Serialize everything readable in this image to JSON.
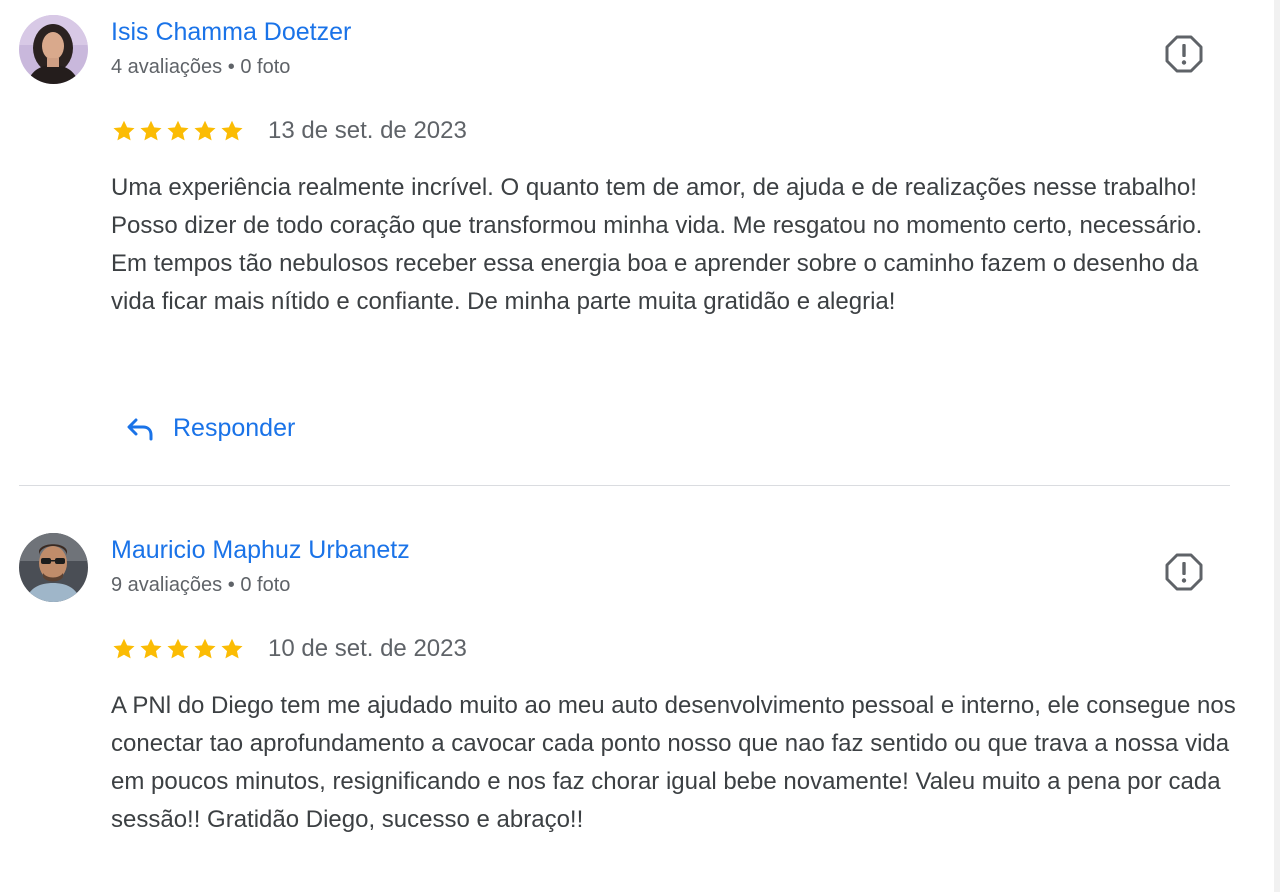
{
  "reviews": [
    {
      "author": "Isis Chamma Doetzer",
      "reviews_count": "4 avaliações",
      "separator": "•",
      "photos_count": "0 foto",
      "rating": 5,
      "date": "13 de set. de 2023",
      "text": "Uma experiência realmente incrível. O quanto tem de amor, de ajuda e de realizações nesse trabalho! Posso dizer de todo coração que transformou minha vida. Me resgatou no momento certo, necessário. Em tempos tão nebulosos receber essa energia boa e aprender sobre o caminho fazem o desenho da vida ficar mais nítido e confiante. De minha parte muita gratidão e alegria!",
      "reply_label": "Responder"
    },
    {
      "author": "Mauricio Maphuz Urbanetz",
      "reviews_count": "9 avaliações",
      "separator": "•",
      "photos_count": "0 foto",
      "rating": 5,
      "date": "10 de set. de 2023",
      "text": "A PNl do Diego tem me ajudado muito ao meu auto desenvolvimento pessoal e interno, ele consegue nos conectar tao aprofundamento a cavocar cada ponto nosso que nao faz sentido ou que trava a nossa vida em poucos minutos, resignificando e nos faz chorar igual bebe novamente! Valeu muito a pena por cada sessão!! Gratidão Diego, sucesso e abraço!!"
    }
  ],
  "icons": {
    "star": "star-icon",
    "flag": "report-flag-icon",
    "reply": "reply-arrow-icon"
  },
  "colors": {
    "link": "#1a73e8",
    "star": "#fbbc04",
    "meta": "#5f6368",
    "body_text": "#3c4043",
    "divider": "#dadce0",
    "icon": "#5f6368"
  }
}
